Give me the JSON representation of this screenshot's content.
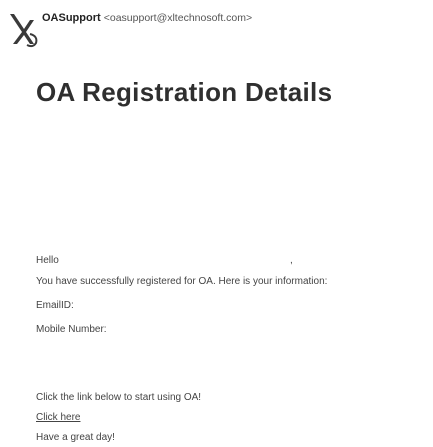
{
  "header": {
    "sender_name": "OASupport",
    "sender_email": "<oasupport@xltechnosoft.com>",
    "logo_icon": "xl-logo-icon"
  },
  "title": "OA Registration Details",
  "body": {
    "greeting": "Hello",
    "greeting_punct": ",",
    "intro": "You have successfully registered for OA. Here is your information:",
    "email_label": "EmailID:",
    "mobile_label": "Mobile Number:",
    "cta_text": "Click the link below to start using OA!",
    "link_text": "Click here",
    "signoff": "Have a great day!"
  },
  "colors": {
    "logo_primary": "#3a3a3a",
    "logo_accent": "#4a6fb5",
    "text": "#444444"
  }
}
